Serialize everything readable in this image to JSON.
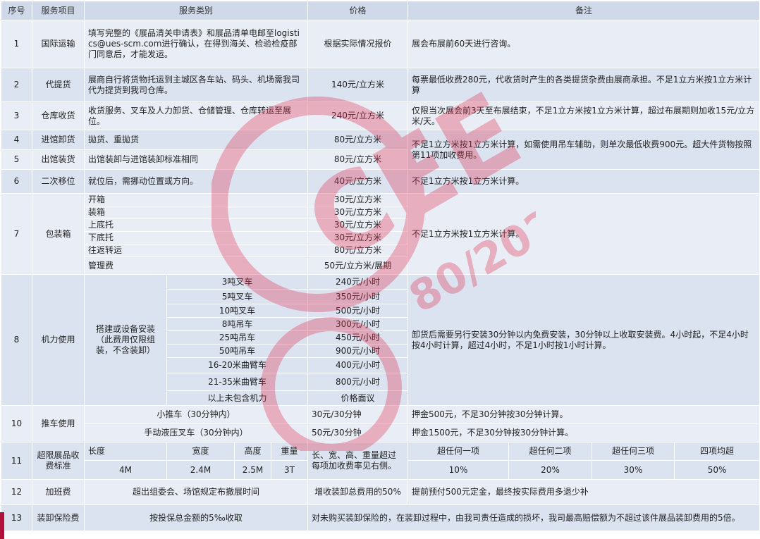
{
  "headers": [
    "序号",
    "服务项目",
    "服务类别",
    "价格",
    "备注"
  ],
  "rows": {
    "r1": {
      "no": "1",
      "item": "国际运输",
      "category": "填写完整的《展品清关申请表》和展品清单电邮至logistics@ues-scm.com进行确认，在得到海关、检验检疫部门同意后，才能发运。",
      "price": "根据实际情况报价",
      "note": "展会布展前60天进行咨询。"
    },
    "r2": {
      "no": "2",
      "item": "代提货",
      "category": "展商自行将货物托运到主城区各车站、码头、机场需我司代为提货到我司仓库。",
      "price": "140元/立方米",
      "note": "每票最低收费280元，代收货时产生的各类提货杂费由展商承担。不足1立方米按1立方米计算"
    },
    "r3": {
      "no": "3",
      "item": "仓库收货",
      "category": "收货服务、叉车及人力卸货、仓储管理、仓库转运至展位。",
      "price": "240元/立方米",
      "note": "仅限当次展会前3天至布展结束，不足1立方米按1立方米计算，超过布展期则加收15元/立方米/天。"
    },
    "r4": {
      "no": "4",
      "item": "进馆卸货",
      "category": "拋货、重拋货",
      "price": "80元/立方米",
      "note": "不足1立方米按1立方米计算，如需使用吊车辅助，则单次最低收费900元。超大件货物按照第11项加收费用。"
    },
    "r5": {
      "no": "5",
      "item": "出馆装货",
      "category": "出馆装卸与进馆装卸标准相同",
      "price": "80元/立方米"
    },
    "r6": {
      "no": "6",
      "item": "二次移位",
      "category": "就位后，需挪动位置或方向。",
      "price": "40元/立方米",
      "note": "不足1立方米按1立方米计算。"
    },
    "r7": {
      "no": "7",
      "item": "包装箱",
      "note": "不足1立方米按1立方米计算。",
      "subs": [
        {
          "category": "开箱",
          "price": "30元/立方米"
        },
        {
          "category": "装箱",
          "price": "30元/立方米"
        },
        {
          "category": "上底托",
          "price": "30元/立方米"
        },
        {
          "category": "下底托",
          "price": "30元/立方米"
        },
        {
          "category": "往返转运",
          "price": "80元/立方米"
        },
        {
          "category": "管理费",
          "price": "50元/立方米/展期"
        }
      ]
    },
    "r8": {
      "no": "8",
      "item": "机力使用",
      "category": "搭建或设备安装（此费用仅限组装，不含装卸）",
      "note": "卸货后需要另行安装30分钟以内免费安装，30分钟以上收取安装费。4小时起，不足4小时按4小时计算，超过4小时，不足1小时按1小时计算。",
      "subs": [
        {
          "type": "3吨叉车",
          "price": "240元/小时"
        },
        {
          "type": "5吨叉车",
          "price": "350元/小时"
        },
        {
          "type": "10吨叉车",
          "price": "500元/小时"
        },
        {
          "type": "8吨吊车",
          "price": "300元/小时"
        },
        {
          "type": "25吨吊车",
          "price": "450元/小时"
        },
        {
          "type": "50吨吊车",
          "price": "900元/小时"
        },
        {
          "type": "16-20米曲臂车",
          "price": "400元/小时"
        },
        {
          "type": "21-35米曲臂车",
          "price": "800元/小时"
        },
        {
          "type": "以上未包含机力",
          "price": "价格面议"
        }
      ]
    },
    "r10": {
      "no": "10",
      "item": "推车使用",
      "subs": [
        {
          "category": "小推车（30分钟内）",
          "price": "30元/30分钟",
          "note": "押金500元，不足30分钟按30分钟计算。"
        },
        {
          "category": "手动液压叉车（30分钟内）",
          "price": "50元/30分钟",
          "note": "押金1500元，不足30分钟按30分钟计算。"
        }
      ]
    },
    "r11": {
      "no": "11",
      "item": "超限展品收费标准",
      "dims": [
        "长度",
        "宽度",
        "高度",
        "重量"
      ],
      "dim_values": [
        "4M",
        "2.4M",
        "2.5M",
        "3T"
      ],
      "price": "长、宽、高、重量超过每项加收费率见右侧。",
      "tiers": [
        "超任何一项",
        "超任何二项",
        "超任何三项",
        "四项均超"
      ],
      "rates": [
        "10%",
        "20%",
        "30%",
        "50%"
      ]
    },
    "r12": {
      "no": "12",
      "item": "加班费",
      "category": "超出组委会、场馆规定布撤展时间",
      "price": "增收装卸总费用的50%",
      "note": "提前预付500元定金，最终按实际费用多退少补"
    },
    "r13": {
      "no": "13",
      "item": "装卸保险费",
      "category": "按投保总金额的5‰收取",
      "note": "对未购买装卸保险的，在装卸过程中，由我司责任造成的损坏，我司最高赔偿额为不超过该件展品装卸费用的5倍。"
    }
  },
  "watermark": {
    "brand": "CEE",
    "line2": "80/2021",
    "color": "#e0304f"
  }
}
